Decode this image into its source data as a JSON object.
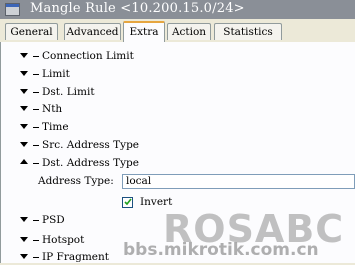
{
  "window": {
    "title": "Mangle Rule <10.200.15.0/24>"
  },
  "tabs": [
    {
      "label": "General"
    },
    {
      "label": "Advanced"
    },
    {
      "label": "Extra",
      "active": true
    },
    {
      "label": "Action"
    },
    {
      "label": "Statistics"
    }
  ],
  "sections": [
    {
      "label": "Connection Limit",
      "state": "collapsed"
    },
    {
      "label": "Limit",
      "state": "collapsed"
    },
    {
      "label": "Dst. Limit",
      "state": "collapsed"
    },
    {
      "label": "Nth",
      "state": "collapsed"
    },
    {
      "label": "Time",
      "state": "collapsed"
    },
    {
      "label": "Src. Address Type",
      "state": "collapsed"
    },
    {
      "label": "Dst. Address Type",
      "state": "expanded"
    },
    {
      "label": "PSD",
      "state": "collapsed"
    },
    {
      "label": "Hotspot",
      "state": "collapsed"
    },
    {
      "label": "IP Fragment",
      "state": "collapsed"
    }
  ],
  "dst_address_type": {
    "field_label": "Address Type:",
    "value": "local",
    "invert_label": "Invert",
    "invert_checked": true
  },
  "watermark": {
    "logo": "ROSABC",
    "url": "bbs.mikrotik.com.cn"
  },
  "colors": {
    "titlebar": "#8a8f97",
    "active_tab_accent": "#e6a640",
    "panel": "#fcfcfe"
  }
}
